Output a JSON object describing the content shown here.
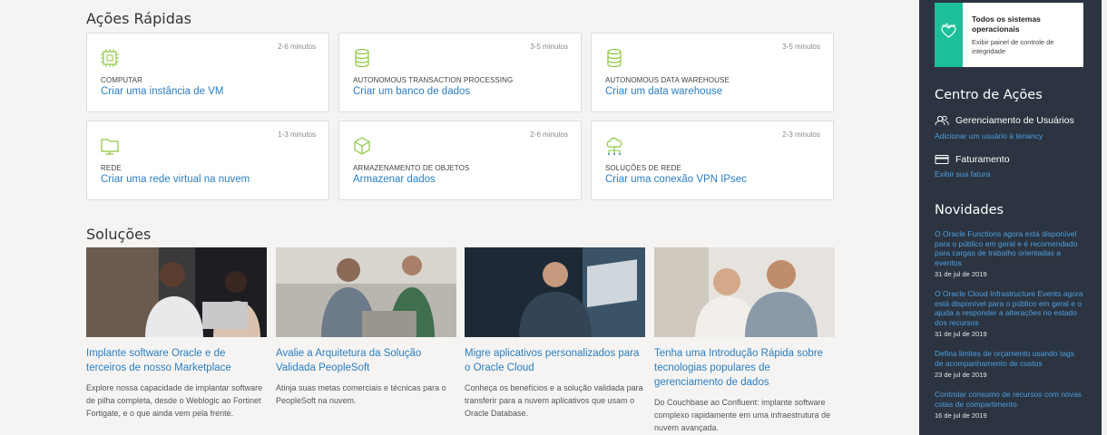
{
  "quick_actions": {
    "title": "Ações Rápidas",
    "cards": [
      {
        "time": "2-6 minutos",
        "category": "COMPUTAR",
        "link": "Criar uma instância de VM",
        "icon": "chip-icon"
      },
      {
        "time": "3-5 minutos",
        "category": "AUTONOMOUS TRANSACTION PROCESSING",
        "link": "Criar um banco de dados",
        "icon": "database-icon"
      },
      {
        "time": "3-5 minutos",
        "category": "AUTONOMOUS DATA WAREHOUSE",
        "link": "Criar um data warehouse",
        "icon": "database-icon"
      },
      {
        "time": "1-3 minutos",
        "category": "REDE",
        "link": "Criar uma rede virtual na nuvem",
        "icon": "network-folder-icon"
      },
      {
        "time": "2-6 minutos",
        "category": "ARMAZENAMENTO DE OBJETOS",
        "link": "Armazenar dados",
        "icon": "cube-icon"
      },
      {
        "time": "2-3 minutos",
        "category": "SOLUÇÕES DE REDE",
        "link": "Criar uma conexão VPN IPsec",
        "icon": "cloud-network-icon"
      }
    ]
  },
  "solutions": {
    "title": "Soluções",
    "items": [
      {
        "title": "Implante software Oracle e de terceiros de nosso Marketplace",
        "desc": "Explore nossa capacidade de implantar software de pilha completa, desde o Weblogic ao Fortinet Fortigate, e o que ainda vem pela frente."
      },
      {
        "title": "Avalie a Arquitetura da Solução Validada PeopleSoft",
        "desc": "Atinja suas metas comerciais e técnicas para o PeopleSoft na nuvem."
      },
      {
        "title": "Migre aplicativos personalizados para o Oracle Cloud",
        "desc": "Conheça os benefícios e a solução validada para transferir para a nuvem aplicativos que usam o Oracle Database."
      },
      {
        "title": "Tenha uma Introdução Rápida sobre tecnologias populares de gerenciamento de dados",
        "desc": "Do Couchbase ao Confluent: implante software complexo rapidamente em uma infraestrutura de nuvem avançada."
      }
    ]
  },
  "sidebar": {
    "status": {
      "title": "Todos os sistemas operacionais",
      "desc": "Exibir painel de controle de integridade"
    },
    "action_center": {
      "title": "Centro de Ações",
      "user_mgmt": "Gerenciamento de Usuários",
      "user_link": "Adicionar um usuário à tenancy",
      "billing": "Faturamento",
      "billing_link": "Exibir sua fatura"
    },
    "news": {
      "title": "Novidades",
      "items": [
        {
          "text": "O Oracle Functions agora está disponível para o público em geral e é recomendado para cargas de trabalho orientadas a eventos",
          "date": "31 de jul de 2019"
        },
        {
          "text": "O Oracle Cloud Infrastructure Events agora está disponível para o público em geral e o ajuda a responder a alterações no estado dos recursos",
          "date": "31 de jul de 2019"
        },
        {
          "text": "Defina limites de orçamento usando tags de acompanhamento de custos",
          "date": "23 de jul de 2019"
        },
        {
          "text": "Controlar consumo de recursos com novas cotas de compartimento",
          "date": "16 de jul de 2019"
        }
      ]
    }
  },
  "colors": {
    "accent": "#2b7ec0",
    "sidebar_bg": "#2b3440",
    "status_green": "#1dbf9a",
    "icon_green": "#8dc63f"
  }
}
